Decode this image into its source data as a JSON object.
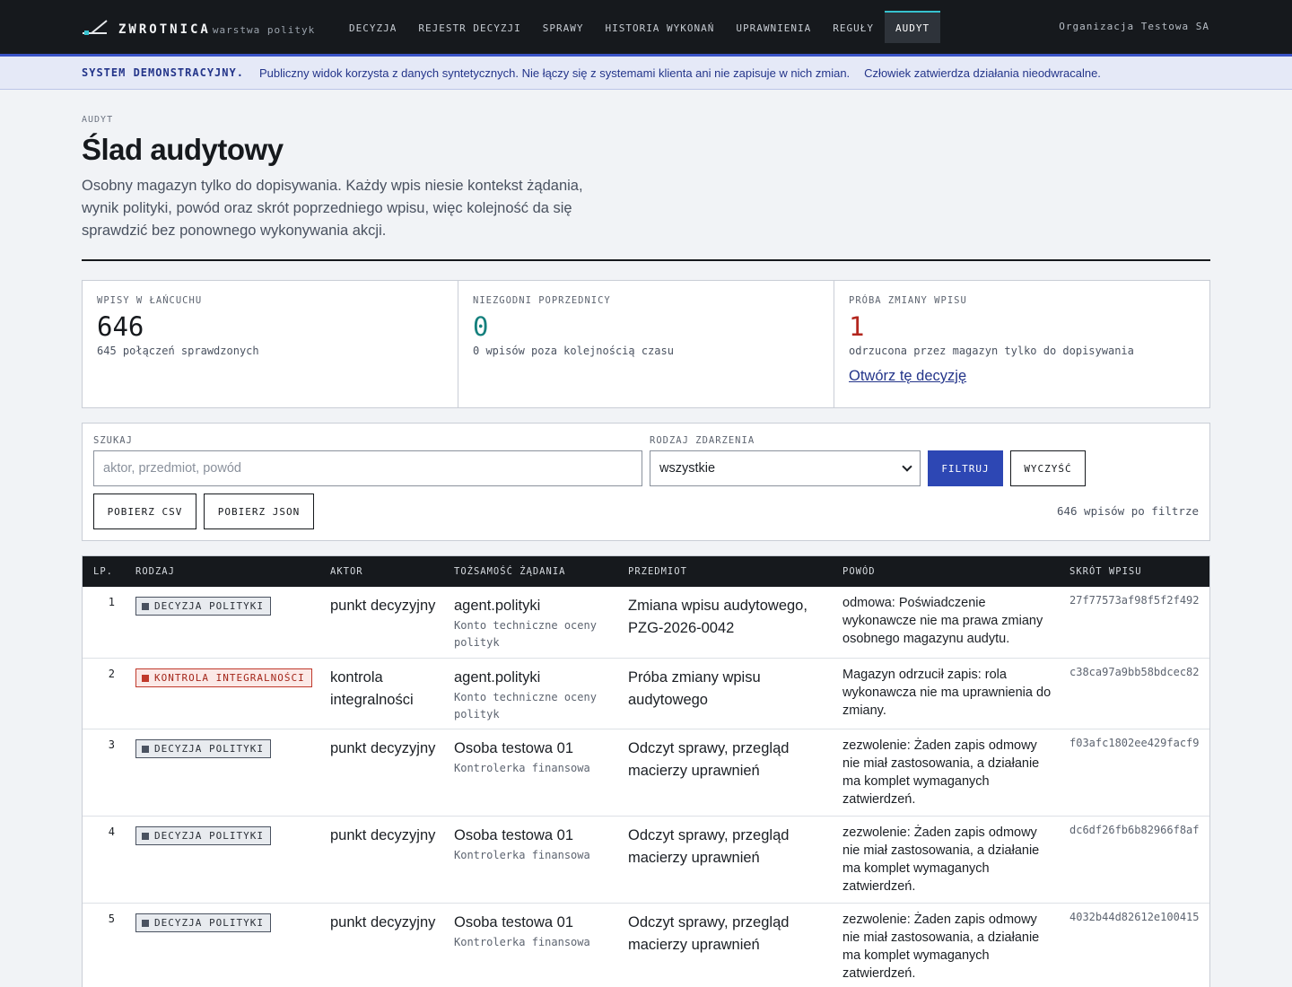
{
  "brand": {
    "name": "ZWROTNICA",
    "sub": "warstwa polityk"
  },
  "nav": [
    {
      "label": "DECYZJA",
      "active": false
    },
    {
      "label": "REJESTR DECYZJI",
      "active": false
    },
    {
      "label": "SPRAWY",
      "active": false
    },
    {
      "label": "HISTORIA WYKONAŃ",
      "active": false
    },
    {
      "label": "UPRAWNIENIA",
      "active": false
    },
    {
      "label": "REGUŁY",
      "active": false
    },
    {
      "label": "AUDYT",
      "active": true
    }
  ],
  "org": "Organizacja Testowa SA",
  "banner": {
    "tag": "SYSTEM DEMONSTRACYJNY.",
    "text1": "Publiczny widok korzysta z danych syntetycznych. Nie łączy się z systemami klienta ani nie zapisuje w nich zmian.",
    "text2": "Człowiek zatwierdza działania nieodwracalne."
  },
  "header": {
    "eyebrow": "AUDYT",
    "title": "Ślad audytowy",
    "lead": "Osobny magazyn tylko do dopisywania. Każdy wpis niesie kontekst żądania, wynik polityki, powód oraz skrót poprzedniego wpisu, więc kolejność da się sprawdzić bez ponownego wykonywania akcji."
  },
  "stats": [
    {
      "label": "WPISY W ŁAŃCUCHU",
      "value": "646",
      "note": "645 połączeń sprawdzonych",
      "color": "#16191d"
    },
    {
      "label": "NIEZGODNI POPRZEDNICY",
      "value": "0",
      "note": "0 wpisów poza kolejnością czasu",
      "color": "#15807d"
    },
    {
      "label": "PRÓBA ZMIANY WPISU",
      "value": "1",
      "note": "odrzucona przez magazyn tylko do dopisywania",
      "color": "#b3261e",
      "link": "Otwórz tę decyzję"
    }
  ],
  "filters": {
    "search_label": "SZUKAJ",
    "search_placeholder": "aktor, przedmiot, powód",
    "search_value": "",
    "type_label": "RODZAJ ZDARZENIA",
    "type_value": "wszystkie",
    "filter_button": "FILTRUJ",
    "clear_button": "WYCZYŚĆ",
    "csv_button": "POBIERZ CSV",
    "json_button": "POBIERZ JSON",
    "count": "646 wpisów po filtrze"
  },
  "table": {
    "columns": [
      "LP.",
      "RODZAJ",
      "AKTOR",
      "TOŻSAMOŚĆ ŻĄDANIA",
      "PRZEDMIOT",
      "POWÓD",
      "SKRÓT WPISU"
    ],
    "rows": [
      {
        "num": "1",
        "type": "DECYZJA POLITYKI",
        "danger": false,
        "actor": "punkt decyzyjny",
        "id_main": "agent.polityki",
        "id_sub": "Konto techniczne oceny polityk",
        "subject": "Zmiana wpisu audytowego, PZG-2026-0042",
        "reason": "odmowa: Poświadczenie wykonawcze nie ma prawa zmiany osobnego magazynu audytu.",
        "hash": "27f77573af98f5f2f492"
      },
      {
        "num": "2",
        "type": "KONTROLA INTEGRALNOŚCI",
        "danger": true,
        "actor": "kontrola integralności",
        "id_main": "agent.polityki",
        "id_sub": "Konto techniczne oceny polityk",
        "subject": "Próba zmiany wpisu audytowego",
        "reason": "Magazyn odrzucił zapis: rola wykonawcza nie ma uprawnienia do zmiany.",
        "hash": "c38ca97a9bb58bdcec82"
      },
      {
        "num": "3",
        "type": "DECYZJA POLITYKI",
        "danger": false,
        "actor": "punkt decyzyjny",
        "id_main": "Osoba testowa 01",
        "id_sub": "Kontrolerka finansowa",
        "subject": "Odczyt sprawy, przegląd macierzy uprawnień",
        "reason": "zezwolenie: Żaden zapis odmowy nie miał zastosowania, a działanie ma komplet wymaganych zatwierdzeń.",
        "hash": "f03afc1802ee429facf9"
      },
      {
        "num": "4",
        "type": "DECYZJA POLITYKI",
        "danger": false,
        "actor": "punkt decyzyjny",
        "id_main": "Osoba testowa 01",
        "id_sub": "Kontrolerka finansowa",
        "subject": "Odczyt sprawy, przegląd macierzy uprawnień",
        "reason": "zezwolenie: Żaden zapis odmowy nie miał zastosowania, a działanie ma komplet wymaganych zatwierdzeń.",
        "hash": "dc6df26fb6b82966f8af"
      },
      {
        "num": "5",
        "type": "DECYZJA POLITYKI",
        "danger": false,
        "actor": "punkt decyzyjny",
        "id_main": "Osoba testowa 01",
        "id_sub": "Kontrolerka finansowa",
        "subject": "Odczyt sprawy, przegląd macierzy uprawnień",
        "reason": "zezwolenie: Żaden zapis odmowy nie miał zastosowania, a działanie ma komplet wymaganych zatwierdzeń.",
        "hash": "4032b44d82612e100415"
      }
    ]
  }
}
